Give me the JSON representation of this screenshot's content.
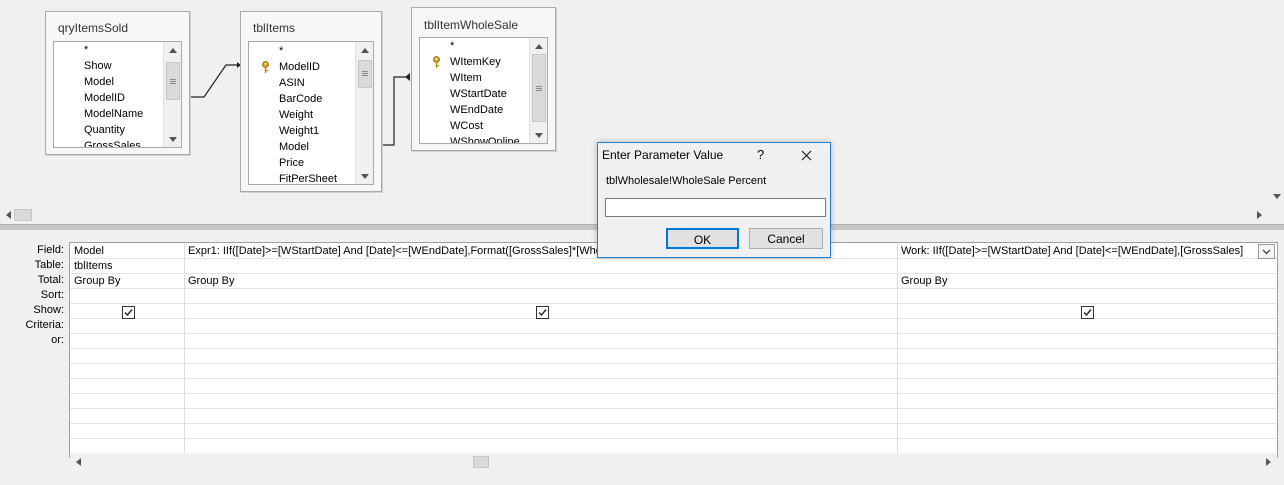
{
  "tables": [
    {
      "name": "qryItemsSold",
      "fields": [
        {
          "label": "*",
          "key": false
        },
        {
          "label": "Show",
          "key": false
        },
        {
          "label": "Model",
          "key": false
        },
        {
          "label": "ModelID",
          "key": false
        },
        {
          "label": "ModelName",
          "key": false
        },
        {
          "label": "Quantity",
          "key": false
        },
        {
          "label": "GrossSales",
          "key": false
        }
      ]
    },
    {
      "name": "tblItems",
      "fields": [
        {
          "label": "*",
          "key": false
        },
        {
          "label": "ModelID",
          "key": true
        },
        {
          "label": "ASIN",
          "key": false
        },
        {
          "label": "BarCode",
          "key": false
        },
        {
          "label": "Weight",
          "key": false
        },
        {
          "label": "Weight1",
          "key": false
        },
        {
          "label": "Model",
          "key": false
        },
        {
          "label": "Price",
          "key": false
        },
        {
          "label": "FitPerSheet",
          "key": false
        }
      ]
    },
    {
      "name": "tblItemWholeSale",
      "fields": [
        {
          "label": "*",
          "key": false
        },
        {
          "label": "WItemKey",
          "key": true
        },
        {
          "label": "WItem",
          "key": false
        },
        {
          "label": "WStartDate",
          "key": false
        },
        {
          "label": "WEndDate",
          "key": false
        },
        {
          "label": "WCost",
          "key": false
        },
        {
          "label": "WShowOnline",
          "key": false
        }
      ]
    }
  ],
  "grid": {
    "row_labels": [
      "Field:",
      "Table:",
      "Total:",
      "Sort:",
      "Show:",
      "Criteria:",
      "or:"
    ],
    "columns": [
      {
        "field": "Model",
        "table": "tblItems",
        "total": "Group By",
        "show": true
      },
      {
        "field": "Expr1: IIf([Date]>=[WStartDate] And [Date]<=[WEndDate],Format([GrossSales]*[WholeSale Percent]/100,\"Currency\"))",
        "table": "",
        "total": "Group By",
        "show": true
      },
      {
        "field": "Work: IIf([Date]>=[WStartDate] And [Date]<=[WEndDate],[GrossSales]",
        "table": "",
        "total": "Group By",
        "show": true
      }
    ]
  },
  "dialog": {
    "title": "Enter Parameter Value",
    "help": "?",
    "prompt": "tblWholesale!WholeSale Percent",
    "value": "",
    "ok_label": "OK",
    "cancel_label": "Cancel"
  },
  "colors": {
    "dialog_border": "#1883d7",
    "accent": "#0078d7",
    "key_icon": "#d4a017"
  }
}
